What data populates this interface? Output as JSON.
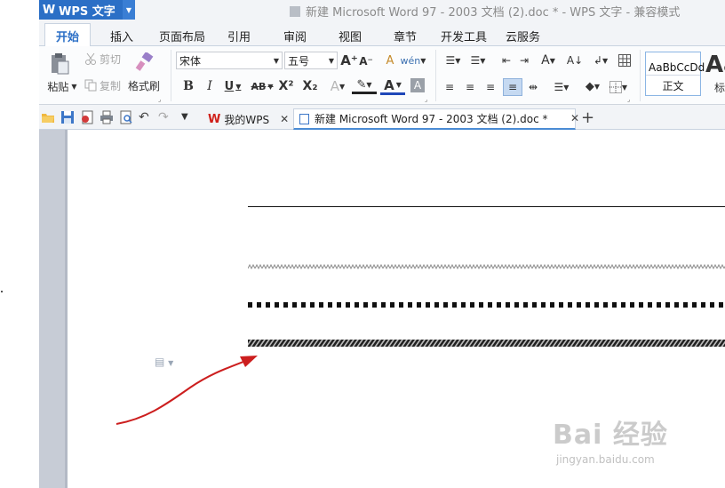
{
  "app": {
    "name": "WPS 文字",
    "window_title": "新建 Microsoft Word 97 - 2003 文档 (2).doc * - WPS 文字 - 兼容模式"
  },
  "ribbon_tabs": [
    "开始",
    "插入",
    "页面布局",
    "引用",
    "审阅",
    "视图",
    "章节",
    "开发工具",
    "云服务"
  ],
  "clipboard": {
    "paste": "粘贴",
    "cut": "剪切",
    "copy": "复制",
    "format_painter": "格式刷"
  },
  "font": {
    "family": "宋体",
    "size": "五号"
  },
  "styles": [
    {
      "sample": "AaBbCcDd",
      "name": "正文"
    },
    {
      "sample": "Aa",
      "name": "标"
    }
  ],
  "doc_tabs": [
    {
      "label": "我的WPS",
      "active": false
    },
    {
      "label": "新建 Microsoft Word 97 - 2003 文档 (2).doc *",
      "active": true
    }
  ],
  "document": {
    "lines": [
      "solid",
      "wavy",
      "dotted",
      "hatched"
    ]
  },
  "watermark": {
    "text": "Bai 经验",
    "url": "jingyan.baidu.com"
  },
  "colors": {
    "accent": "#2b6fc6",
    "margin_bar": "#c7ccd6",
    "arrow": "#cc1e1e"
  }
}
